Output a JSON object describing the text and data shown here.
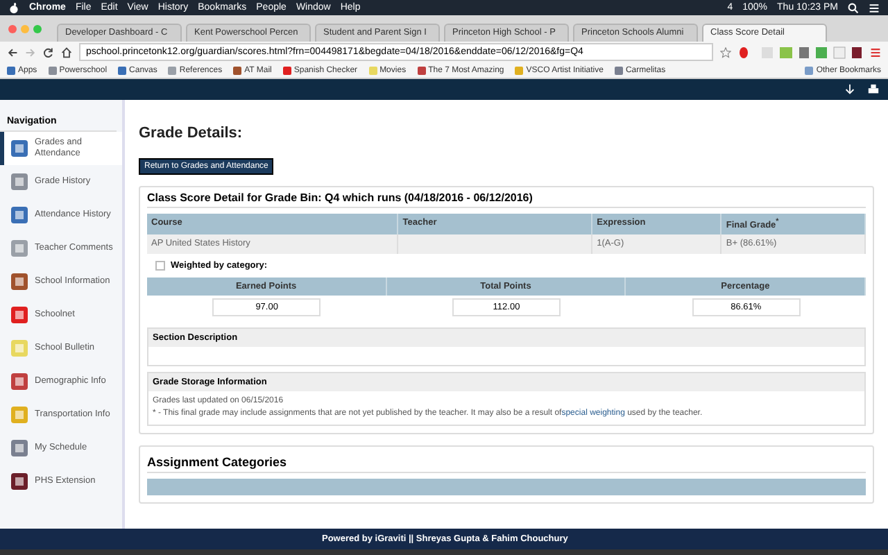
{
  "menubar": {
    "app": "Chrome",
    "menus": [
      "File",
      "Edit",
      "View",
      "History",
      "Bookmarks",
      "People",
      "Window",
      "Help"
    ],
    "status": [
      "4",
      "100%",
      "Thu 10:23 PM"
    ]
  },
  "tabs": [
    {
      "label": "Developer Dashboard - C",
      "selected": false
    },
    {
      "label": "Kent Powerschool Percen",
      "selected": false
    },
    {
      "label": "Student and Parent Sign I",
      "selected": false
    },
    {
      "label": "Princeton High School - P",
      "selected": false
    },
    {
      "label": "Princeton Schools Alumni",
      "selected": false
    },
    {
      "label": "Class Score Detail",
      "selected": true
    }
  ],
  "address": "pschool.princetonk12.org/guardian/scores.html?frn=004498171&begdate=04/18/2016&enddate=06/12/2016&fg=Q4",
  "bookmarks": [
    "Apps",
    "Powerschool",
    "Canvas",
    "References",
    "AT Mail",
    "Spanish Checker",
    "Movies",
    "The 7 Most Amazing",
    "VSCO Artist Initiative",
    "Carmelitas"
  ],
  "other_bookmarks": "Other Bookmarks",
  "sidebar": {
    "title": "Navigation",
    "items": [
      {
        "label": "Grades and Attendance",
        "selected": true
      },
      {
        "label": "Grade History",
        "selected": false
      },
      {
        "label": "Attendance History",
        "selected": false
      },
      {
        "label": "Teacher Comments",
        "selected": false
      },
      {
        "label": "School Information",
        "selected": false
      },
      {
        "label": "Schoolnet",
        "selected": false
      },
      {
        "label": "School Bulletin",
        "selected": false
      },
      {
        "label": "Demographic Info",
        "selected": false
      },
      {
        "label": "Transportation Info",
        "selected": false
      },
      {
        "label": "My Schedule",
        "selected": false
      },
      {
        "label": "PHS Extension",
        "selected": false
      }
    ]
  },
  "heading": "Grade Details:",
  "return_button": "Return to Grades and Attendance",
  "detail": {
    "title": "Class Score Detail for Grade Bin: Q4 which runs (04/18/2016 - 06/12/2016)",
    "columns": [
      "Course",
      "Teacher",
      "Expression",
      "Final Grade$^{*}$"
    ],
    "row": {
      "course": "AP United States History",
      "expression": "1(A-G)",
      "final_grade": "B+   (86.61%)"
    },
    "weighted": {
      "label": "Weighted by category:",
      "checked": false
    },
    "points_columns": [
      "Earned Points",
      "Total Points",
      "Percentage"
    ],
    "points": [
      "97.00",
      "112.00",
      "86.61%"
    ],
    "section_description": "Section Description",
    "storage_title": "Grade Storage Information",
    "updated": "Grades last updated on 06/15/2016",
    "note_before": "* - This final grade may include assignments that are not yet published by the teacher. It may also be a result of",
    "note_link": "special weighting",
    "note_after": " used by the teacher."
  },
  "categories_title": "Assignment Categories",
  "footer": "Powered by iGraviti || Shreyas Gupta & Fahim Chouchury"
}
